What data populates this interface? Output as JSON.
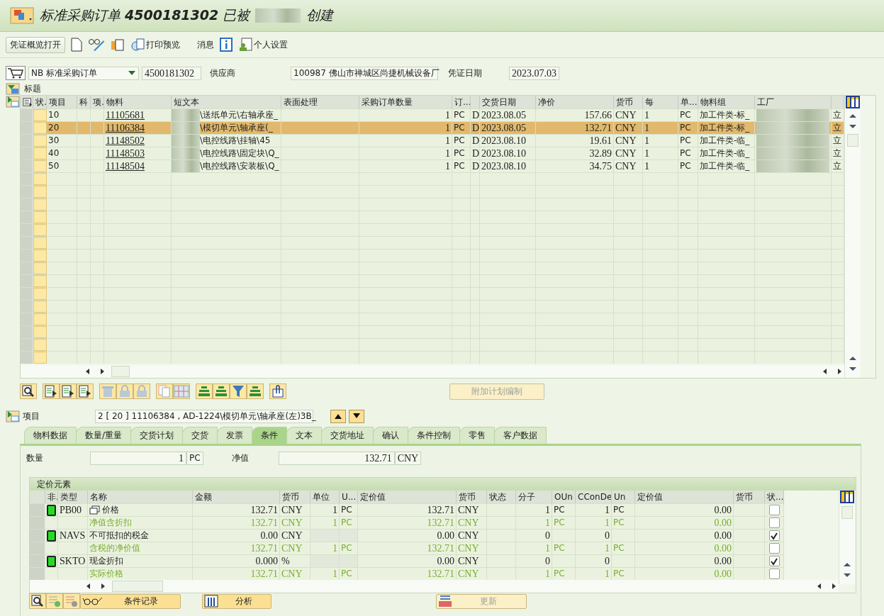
{
  "window": {
    "title_start": "标准采购订单 **4500181302** 已被",
    "title_end": "创建"
  },
  "toolbar": {
    "overview_button": "凭证概览打开",
    "print_preview": "打印预览",
    "messages": "消息",
    "personal_settings": "个人设置"
  },
  "header": {
    "doc_type": "NB 标准采购订单",
    "po_number": "4500181302",
    "vendor_label": "供应商",
    "vendor": "100987 佛山市禅城区尚捷机械设备厂",
    "date_label": "凭证日期",
    "date": "2023.07.03",
    "section_label": "标题"
  },
  "items": {
    "columns": [
      {
        "label": "状."
      },
      {
        "label": "项目"
      },
      {
        "label": "科"
      },
      {
        "label": "项."
      },
      {
        "label": "物料"
      },
      {
        "label": "短文本"
      },
      {
        "label": "表面处理"
      },
      {
        "label": "采购订单数量"
      },
      {
        "label": "订..."
      },
      {},
      {
        "label": "交货日期"
      },
      {
        "label": "净价"
      },
      {
        "label": "货币"
      },
      {
        "label": "每"
      },
      {
        "label": "单..."
      },
      {
        "label": "物料组"
      },
      {
        "label": "工厂"
      },
      {}
    ],
    "rows": [
      {
        "item": "10",
        "material": "11105681",
        "short_text": "\\送纸单元\\右轴承座_",
        "quantity": "1",
        "order_unit": "PC",
        "flag": "D",
        "delivery_date": "2023.08.05",
        "net_price": "157.66",
        "currency": "CNY",
        "per": "1",
        "price_unit": "PC",
        "material_group": "加工件类-标_",
        "column_18": "立",
        "selected": false
      },
      {
        "item": "20",
        "material": "11106384",
        "short_text": "\\模切单元\\轴承座(_",
        "quantity": "1",
        "order_unit": "PC",
        "flag": "D",
        "delivery_date": "2023.08.05",
        "net_price": "132.71",
        "currency": "CNY",
        "per": "1",
        "price_unit": "PC",
        "material_group": "加工件类-标_",
        "column_18": "立",
        "selected": true
      },
      {
        "item": "30",
        "material": "11148502",
        "short_text": "\\电控线路\\挂轴\\45",
        "quantity": "1",
        "order_unit": "PC",
        "flag": "D",
        "delivery_date": "2023.08.10",
        "net_price": "19.61",
        "currency": "CNY",
        "per": "1",
        "price_unit": "PC",
        "material_group": "加工件类-临_",
        "column_18": "立",
        "selected": false
      },
      {
        "item": "40",
        "material": "11148503",
        "short_text": "\\电控线路\\固定块\\Q_",
        "quantity": "1",
        "order_unit": "PC",
        "flag": "D",
        "delivery_date": "2023.08.10",
        "net_price": "32.89",
        "currency": "CNY",
        "per": "1",
        "price_unit": "PC",
        "material_group": "加工件类-临_",
        "column_18": "立",
        "selected": false
      },
      {
        "item": "50",
        "material": "11148504",
        "short_text": "\\电控线路\\安装板\\Q_",
        "quantity": "1",
        "order_unit": "PC",
        "flag": "D",
        "delivery_date": "2023.08.10",
        "net_price": "34.75",
        "currency": "CNY",
        "per": "1",
        "price_unit": "PC",
        "material_group": "加工件类-临_",
        "column_18": "立",
        "selected": false
      }
    ]
  },
  "schedule_button": {
    "label": "附加计划编制",
    "disabled": true
  },
  "item_detail": {
    "label": "项目",
    "value": "2 [ 20 ] 11106384 , AD-1224\\模切单元\\轴承座(左)3B_"
  },
  "tabs": [
    {
      "label": "物料数据",
      "selected": false
    },
    {
      "label": "数量/重量",
      "selected": false
    },
    {
      "label": "交货计划",
      "selected": false
    },
    {
      "label": "交货",
      "selected": false
    },
    {
      "label": "发票",
      "selected": false
    },
    {
      "label": "条件",
      "selected": true
    },
    {
      "label": "文本",
      "selected": false
    },
    {
      "label": "交货地址",
      "selected": false
    },
    {
      "label": "确认",
      "selected": false
    },
    {
      "label": "条件控制",
      "selected": false
    },
    {
      "label": "零售",
      "selected": false
    },
    {
      "label": "客户数据",
      "selected": false
    }
  ],
  "conditions": {
    "quantity_label": "数量",
    "quantity": "1",
    "quantity_unit": "PC",
    "net_label": "净值",
    "net_value": "132.71",
    "net_currency": "CNY"
  },
  "pricing": {
    "title": "定价元素",
    "columns": [
      "非.",
      "类型",
      "名称",
      "金额",
      "货币",
      "单位",
      "U...",
      "定价值",
      "货币",
      "状态",
      "分子",
      "OUn",
      "CConDe",
      "Un",
      "定价值",
      "货币",
      "状..."
    ],
    "rows": [
      {
        "kind": "condition",
        "type": "PB00",
        "name": "价格",
        "amount": "132.71",
        "currency": "CNY",
        "per": "1",
        "unit": "PC",
        "value": "132.71",
        "value_currency": "CNY",
        "numerator": "1",
        "oun": "PC",
        "denominator": "1",
        "un": "PC",
        "value_2": "0.00",
        "checked": false
      },
      {
        "kind": "subtotal",
        "name": "净值含折扣",
        "amount": "132.71",
        "currency": "CNY",
        "per": "1",
        "unit": "PC",
        "value": "132.71",
        "value_currency": "CNY",
        "numerator": "1",
        "oun": "PC",
        "denominator": "1",
        "un": "PC",
        "value_2": "0.00",
        "checked": false
      },
      {
        "kind": "condition",
        "type": "NAVS",
        "name": "不可抵扣的税金",
        "amount": "0.00",
        "currency": "CNY",
        "value": "0.00",
        "value_currency": "CNY",
        "numerator": "0",
        "denominator": "0",
        "value_2": "0.00",
        "checked": true
      },
      {
        "kind": "subtotal",
        "name": "含税的净价值",
        "amount": "132.71",
        "currency": "CNY",
        "per": "1",
        "unit": "PC",
        "value": "132.71",
        "value_currency": "CNY",
        "numerator": "1",
        "oun": "PC",
        "denominator": "1",
        "un": "PC",
        "value_2": "0.00",
        "checked": false
      },
      {
        "kind": "condition",
        "type": "SKTO",
        "name": "现金折扣",
        "amount": "0.000",
        "currency": "%",
        "value": "0.00",
        "value_currency": "CNY",
        "numerator": "0",
        "denominator": "0",
        "value_2": "0.00",
        "checked": true
      },
      {
        "kind": "subtotal",
        "name": "实际价格",
        "amount": "132.71",
        "currency": "CNY",
        "per": "1",
        "unit": "PC",
        "value": "132.71",
        "value_currency": "CNY",
        "numerator": "1",
        "oun": "PC",
        "denominator": "1",
        "un": "PC",
        "value_2": "0.00",
        "checked": false
      }
    ]
  },
  "buttons": [
    {
      "label": "条件记录",
      "disabled": false
    },
    {
      "label": "分析",
      "disabled": false
    },
    {
      "label": "更新",
      "disabled": true
    }
  ]
}
